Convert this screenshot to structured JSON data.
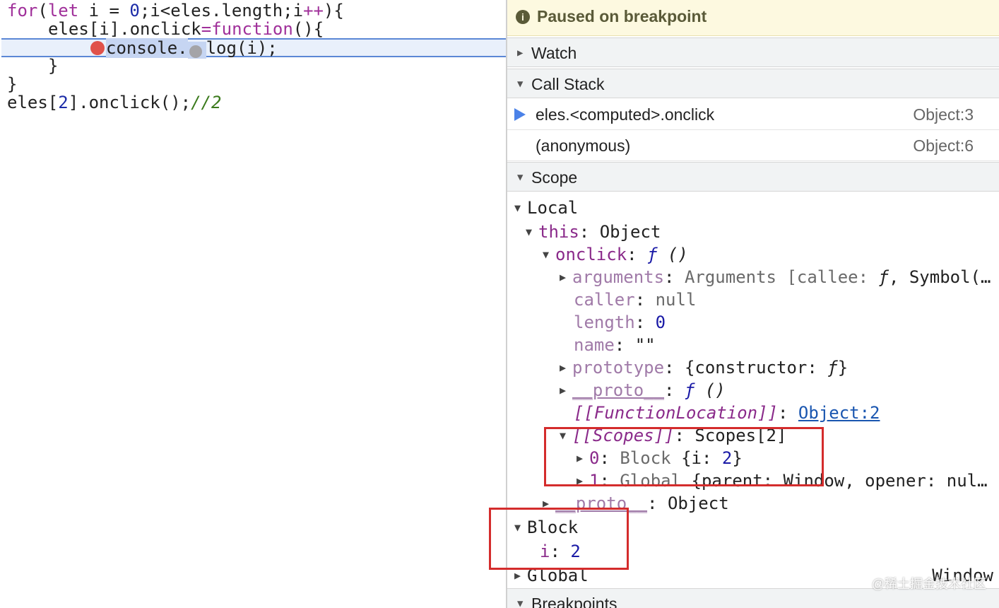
{
  "editor": {
    "lines": [
      {
        "kw1": "for",
        "p1": "(",
        "kw2": "let",
        "p2": " i = ",
        "n1": "0",
        "p3": ";i<eles.length;i",
        "op": "++",
        "p4": "){"
      },
      {
        "a": "eles[i].onclick",
        "op": "=",
        "kw": "function",
        "b": "(){"
      },
      {
        "a": "console.",
        "b": "log(i);"
      },
      {
        "a": "}"
      },
      {
        "a": "}"
      },
      {
        "a": "eles[",
        "n": "2",
        "b": "].onclick();",
        "cmt": "//2"
      }
    ]
  },
  "debugger": {
    "paused_icon": "i",
    "paused_text": "Paused on breakpoint",
    "sections": {
      "watch": "Watch",
      "call_stack": "Call Stack",
      "scope": "Scope",
      "breakpoints": "Breakpoints"
    },
    "call_stack": [
      {
        "fn": "eles.<computed>.onclick",
        "loc": "Object:3"
      },
      {
        "fn": "(anonymous)",
        "loc": "Object:6"
      }
    ],
    "scope": {
      "local": "Local",
      "this_key": "this",
      "this_val": "Object",
      "onclick_key": "onclick",
      "onclick_f": "ƒ",
      "onclick_paren": "()",
      "arguments_key": "arguments",
      "arguments_val": "Arguments [callee: ",
      "arguments_f": "ƒ",
      "arguments_rest": ", Symbol(…",
      "caller_key": "caller",
      "caller_val": "null",
      "length_key": "length",
      "length_val": "0",
      "name_key": "name",
      "name_val": "\"\"",
      "prototype_key": "prototype",
      "prototype_val_a": "{constructor: ",
      "prototype_f": "ƒ",
      "prototype_val_b": "}",
      "proto_key": "__proto__",
      "proto_f": "ƒ",
      "proto_paren": "()",
      "fnloc_key": "[[FunctionLocation]]",
      "fnloc_val": "Object:2",
      "scopes_key": "[[Scopes]]",
      "scopes_val": "Scopes[2]",
      "scope0_key": "0",
      "scope0_type": "Block",
      "scope0_a": "{i: ",
      "scope0_n": "2",
      "scope0_b": "}",
      "scope1_key": "1",
      "scope1_type": "Global",
      "scope1_val": "{parent: Window, opener: nul…",
      "proto2_key": "__proto__",
      "proto2_val": "Object",
      "block": "Block",
      "block_i_key": "i",
      "block_i_val": "2",
      "global": "Global",
      "global_val": "Window"
    },
    "watermark": "@稀土掘金技术社区"
  }
}
